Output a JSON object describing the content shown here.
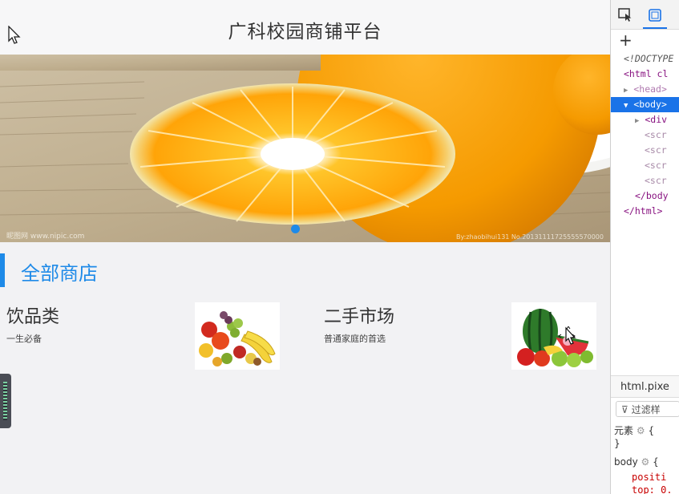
{
  "header": {
    "title": "广科校园商铺平台"
  },
  "banner": {
    "watermark_left": "昵图网 www.nipic.com",
    "watermark_right": "By:zhaobihui131 No.20131111725555570000",
    "active_dot_color": "#1e8ae8"
  },
  "section": {
    "title": "全部商店",
    "accent_color": "#1e8ae8"
  },
  "shops": [
    {
      "name": "饮品类",
      "desc": "一生必备",
      "image_icon": "fruit-assortment-image"
    },
    {
      "name": "二手市场",
      "desc": "普通家庭的首选",
      "image_icon": "watermelon-fruits-image"
    }
  ],
  "devtools": {
    "tree": [
      {
        "text": "<!DOCTYPE",
        "selected": false
      },
      {
        "text": "<html cl",
        "selected": false
      },
      {
        "text": "<head>",
        "selected": false
      },
      {
        "text": "<body>",
        "selected": true
      },
      {
        "text": "<div",
        "selected": false
      },
      {
        "text": "<scr",
        "selected": false
      },
      {
        "text": "<scr",
        "selected": false
      },
      {
        "text": "<scr",
        "selected": false
      },
      {
        "text": "<scr",
        "selected": false
      },
      {
        "text": "</body",
        "selected": false
      },
      {
        "text": "</html>",
        "selected": false
      }
    ],
    "bottom_tab": "html.pixe",
    "filter_placeholder": "过滤样",
    "element_rule": "元素",
    "element_rule_brace": "{",
    "element_rule_close": "}",
    "body_rule": "body",
    "body_rule_brace": "{",
    "prop_1": "positi",
    "prop_2": "top: 0."
  }
}
